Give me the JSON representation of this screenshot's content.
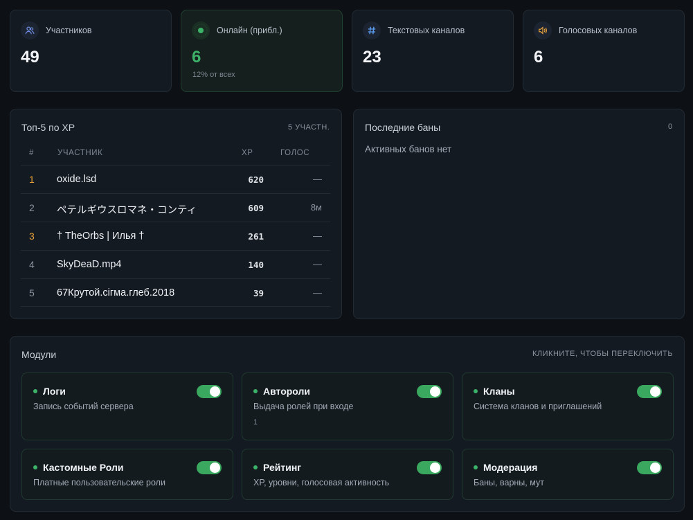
{
  "stats": [
    {
      "label": "Участников",
      "value": "49",
      "icon": "users-icon"
    },
    {
      "label": "Онлайн (прибл.)",
      "value": "6",
      "sub": "12% от всех",
      "icon": "online-dot-icon"
    },
    {
      "label": "Текстовых каналов",
      "value": "23",
      "icon": "hash-icon"
    },
    {
      "label": "Голосовых каналов",
      "value": "6",
      "icon": "speaker-icon"
    }
  ],
  "top": {
    "title": "Топ-5 по XP",
    "count": "5 УЧАСТН.",
    "headers": {
      "rank": "#",
      "member": "УЧАСТНИК",
      "xp": "XP",
      "voice": "ГОЛОС"
    },
    "rows": [
      {
        "rank": "1",
        "name": "oxide.lsd",
        "xp": "620",
        "voice": "—"
      },
      {
        "rank": "2",
        "name": "ペテルギウスロマネ・コンティ",
        "xp": "609",
        "voice": "8м"
      },
      {
        "rank": "3",
        "name": "† TheOrbs | Илья †",
        "xp": "261",
        "voice": "—"
      },
      {
        "rank": "4",
        "name": "SkyDeaD.mp4",
        "xp": "140",
        "voice": "—"
      },
      {
        "rank": "5",
        "name": "67Крутой.сігма.глеб.2018",
        "xp": "39",
        "voice": "—"
      }
    ]
  },
  "bans": {
    "title": "Последние баны",
    "count": "0",
    "empty": "Активных банов нет"
  },
  "modules": {
    "title": "Модули",
    "hint": "КЛИКНИТЕ, ЧТОБЫ ПЕРЕКЛЮЧИТЬ",
    "items": [
      {
        "name": "Логи",
        "desc": "Запись событий сервера",
        "enabled": true
      },
      {
        "name": "Автороли",
        "desc": "Выдача ролей при входе",
        "extra": "1",
        "enabled": true
      },
      {
        "name": "Кланы",
        "desc": "Система кланов и приглашений",
        "enabled": true
      },
      {
        "name": "Кастомные Роли",
        "desc": "Платные пользовательские роли",
        "enabled": true
      },
      {
        "name": "Рейтинг",
        "desc": "XP, уровни, голосовая активность",
        "enabled": true
      },
      {
        "name": "Модерация",
        "desc": "Баны, варны, мут",
        "enabled": true
      }
    ]
  },
  "colors": {
    "accent": "#3db36a",
    "gold": "#e8a13a",
    "background": "#0d1116",
    "card": "#141a21"
  }
}
